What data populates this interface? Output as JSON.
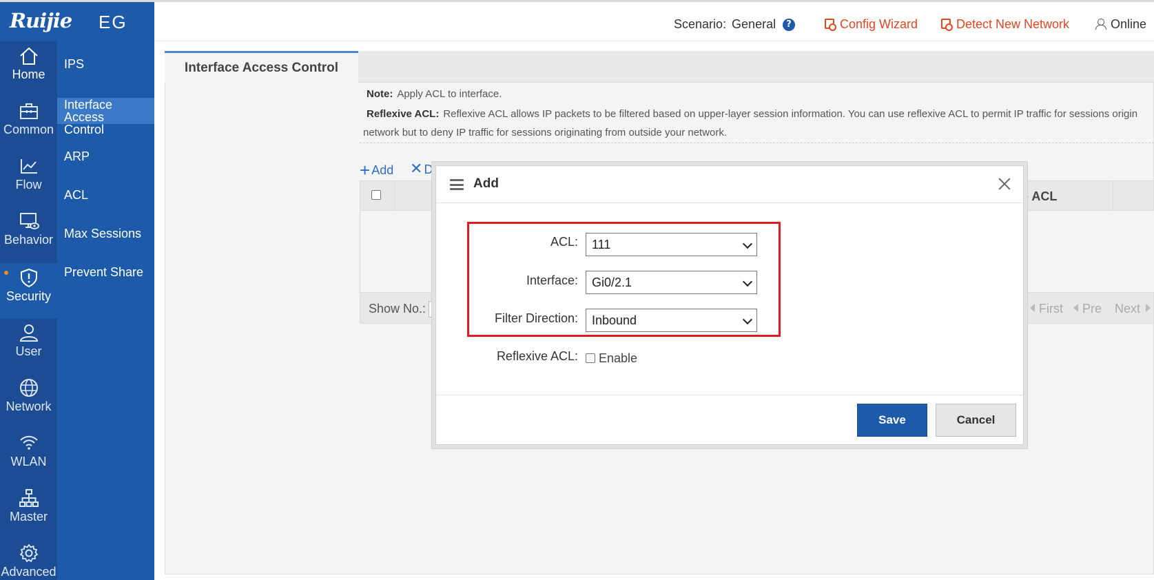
{
  "header": {
    "brand": "Ruijie",
    "model": "EG",
    "scenario_label": "Scenario:",
    "scenario_value": "General",
    "config_wizard": "Config Wizard",
    "detect_network": "Detect New Network",
    "online": "Online",
    "accent_color": "#e8451f",
    "brand_color": "#1d5aaa"
  },
  "nav": {
    "items": [
      {
        "label": "Home",
        "icon": "home-icon"
      },
      {
        "label": "Common",
        "icon": "briefcase-icon"
      },
      {
        "label": "Flow",
        "icon": "line-chart-icon"
      },
      {
        "label": "Behavior",
        "icon": "monitor-eye-icon"
      },
      {
        "label": "Security",
        "icon": "shield-icon"
      },
      {
        "label": "User",
        "icon": "user-icon"
      },
      {
        "label": "Network",
        "icon": "globe-icon"
      },
      {
        "label": "WLAN",
        "icon": "wifi-icon"
      },
      {
        "label": "Master",
        "icon": "org-chart-icon"
      },
      {
        "label": "Advanced",
        "icon": "gear-icon"
      }
    ],
    "active": "Security"
  },
  "subnav": {
    "items": [
      "IPS",
      "Interface Access Control",
      "ARP",
      "ACL",
      "Max Sessions",
      "Prevent Share"
    ],
    "item1_line1": "Interface Access",
    "item1_line2": "Control",
    "selected": "Interface Access Control"
  },
  "page": {
    "tab": "Interface Access Control",
    "note_label": "Note:",
    "note_text": "Apply ACL to interface.",
    "reflexive_label": "Reflexive ACL:",
    "reflexive_text": "Reflexive ACL allows IP packets to be filtered based on upper-layer session information. You can use reflexive ACL to permit IP traffic for sessions origin",
    "reflexive_text_cont": "network but to deny IP traffic for sessions originating from outside your network.",
    "add_label": "Add",
    "delete_label": "D",
    "column_reflexive": "e ACL",
    "show_no": "Show No.:",
    "pager": {
      "first": "First",
      "prev": "Pre",
      "next": "Next"
    }
  },
  "modal": {
    "title": "Add",
    "fields": {
      "acl_label": "ACL:",
      "acl_value": "111",
      "interface_label": "Interface:",
      "interface_value": "Gi0/2.1",
      "direction_label": "Filter Direction:",
      "direction_value": "Inbound",
      "reflexive_label": "Reflexive ACL:",
      "reflexive_enable": "Enable"
    },
    "save": "Save",
    "cancel": "Cancel",
    "highlight_color": "#e01b24"
  }
}
